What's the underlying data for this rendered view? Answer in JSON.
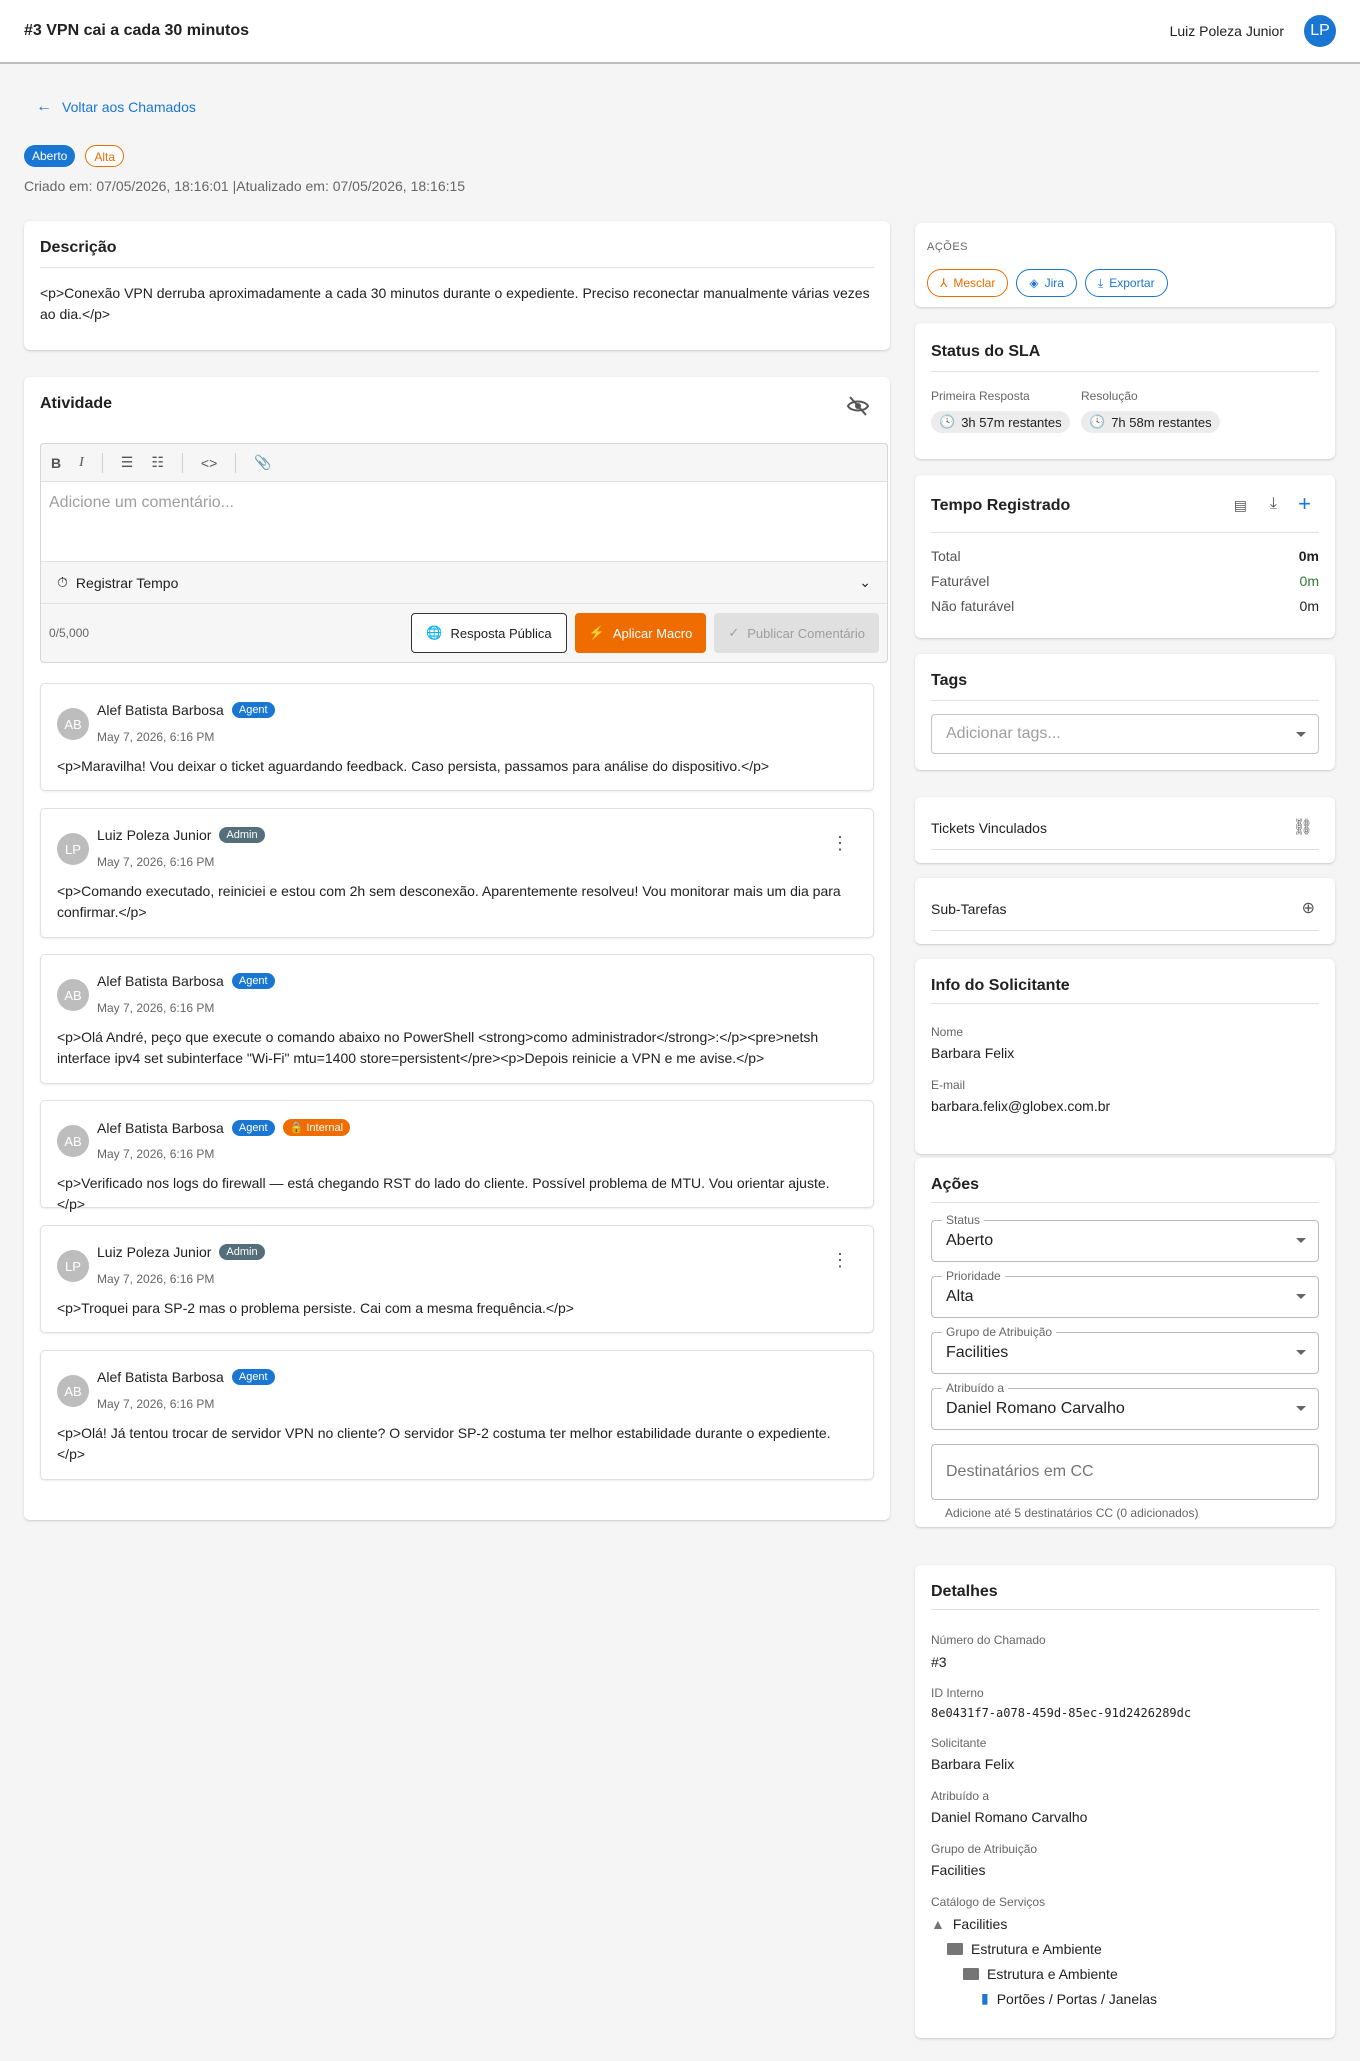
{
  "header": {
    "title": "#3 VPN cai a cada 30 minutos",
    "user_name": "Luiz Poleza Junior",
    "avatar_initials": "LP"
  },
  "back_link": "Voltar aos Chamados",
  "chips": {
    "status": "Aberto",
    "priority": "Alta"
  },
  "meta": "Criado em: 07/05/2026, 18:16:01 |Atualizado em: 07/05/2026, 18:16:15",
  "description": {
    "title": "Descrição",
    "text": "<p>Conexão VPN derruba aproximadamente a cada 30 minutos durante o expediente. Preciso reconectar manualmente várias vezes ao dia.</p>"
  },
  "activity": {
    "title": "Atividade",
    "toolbar": {
      "bold": "B",
      "italic": "I",
      "code": "<>"
    },
    "comment_placeholder": "Adicione um comentário...",
    "register_time": "Registrar Tempo",
    "counter": "0/5,000",
    "btn_public": "Resposta Pública",
    "btn_macro": "Aplicar Macro",
    "btn_publish": "Publicar Comentário",
    "comments": [
      {
        "initials": "AB",
        "author": "Alef Batista Barbosa",
        "role": "Agent",
        "internal": "",
        "date": "May 7, 2026, 6:16 PM",
        "text": "<p>Maravilha! Vou deixar o ticket aguardando feedback. Caso persista, passamos para análise do dispositivo.</p>"
      },
      {
        "initials": "LP",
        "author": "Luiz Poleza Junior",
        "role": "Admin",
        "internal": "",
        "date": "May 7, 2026, 6:16 PM",
        "text": "<p>Comando executado, reiniciei e estou com 2h sem desconexão. Aparentemente resolveu! Vou monitorar mais um dia para confirmar.</p>"
      },
      {
        "initials": "AB",
        "author": "Alef Batista Barbosa",
        "role": "Agent",
        "internal": "",
        "date": "May 7, 2026, 6:16 PM",
        "text": "<p>Olá André, peço que execute o comando abaixo no PowerShell <strong>como administrador</strong>:</p><pre>netsh interface ipv4 set subinterface \"Wi-Fi\" mtu=1400 store=persistent</pre><p>Depois reinicie a VPN e me avise.</p>"
      },
      {
        "initials": "AB",
        "author": "Alef Batista Barbosa",
        "role": "Agent",
        "internal": "Internal",
        "date": "May 7, 2026, 6:16 PM",
        "text": "<p>Verificado nos logs do firewall — está chegando RST do lado do cliente. Possível problema de MTU. Vou orientar ajuste.</p>"
      },
      {
        "initials": "LP",
        "author": "Luiz Poleza Junior",
        "role": "Admin",
        "internal": "",
        "date": "May 7, 2026, 6:16 PM",
        "text": "<p>Troquei para SP-2 mas o problema persiste. Cai com a mesma frequência.</p>"
      },
      {
        "initials": "AB",
        "author": "Alef Batista Barbosa",
        "role": "Agent",
        "internal": "",
        "date": "May 7, 2026, 6:16 PM",
        "text": "<p>Olá! Já tentou trocar de servidor VPN no cliente? O servidor SP-2 costuma ter melhor estabilidade durante o expediente.</p>"
      }
    ]
  },
  "actions_top": {
    "title": "AÇÕES",
    "merge": "Mesclar",
    "jira": "Jira",
    "export": "Exportar"
  },
  "sla": {
    "title": "Status do SLA",
    "first_label": "Primeira Resposta",
    "first_value": "3h 57m restantes",
    "res_label": "Resolução",
    "res_value": "7h 58m restantes"
  },
  "time": {
    "title": "Tempo Registrado",
    "rows": [
      {
        "label": "Total",
        "value": "0m"
      },
      {
        "label": "Faturável",
        "value": "0m"
      },
      {
        "label": "Não faturável",
        "value": "0m"
      }
    ],
    "billable_color": "#2e7d32"
  },
  "tags": {
    "title": "Tags",
    "placeholder": "Adicionar tags..."
  },
  "linked": {
    "title": "Tickets Vinculados"
  },
  "subtasks": {
    "title": "Sub-Tarefas"
  },
  "requester": {
    "title": "Info do Solicitante",
    "name_label": "Nome",
    "name": "Barbara Felix",
    "email_label": "E-mail",
    "email": "barbara.felix@globex.com.br"
  },
  "form": {
    "title": "Ações",
    "status_label": "Status",
    "status": "Aberto",
    "priority_label": "Prioridade",
    "priority": "Alta",
    "group_label": "Grupo de Atribuição",
    "group": "Facilities",
    "assignee_label": "Atribuído a",
    "assignee": "Daniel Romano Carvalho",
    "cc_placeholder": "Destinatários em CC",
    "cc_hint": "Adicione até 5 destinatários CC (0 adicionados)"
  },
  "details": {
    "title": "Detalhes",
    "number_label": "Número do Chamado",
    "number": "#3",
    "id_label": "ID Interno",
    "id": "8e0431f7-a078-459d-85ec-91d2426289dc",
    "requester_label": "Solicitante",
    "requester": "Barbara Felix",
    "assignee_label": "Atribuído a",
    "assignee": "Daniel Romano Carvalho",
    "group_label": "Grupo de Atribuição",
    "group": "Facilities",
    "catalog_label": "Catálogo de Serviços",
    "catalog": [
      "Facilities",
      "Estrutura e Ambiente",
      "Estrutura e Ambiente",
      "Portões / Portas / Janelas"
    ]
  },
  "colors": {
    "primary": "#1976d2",
    "orange": "#ef6c00",
    "admin": "#546e7a"
  }
}
